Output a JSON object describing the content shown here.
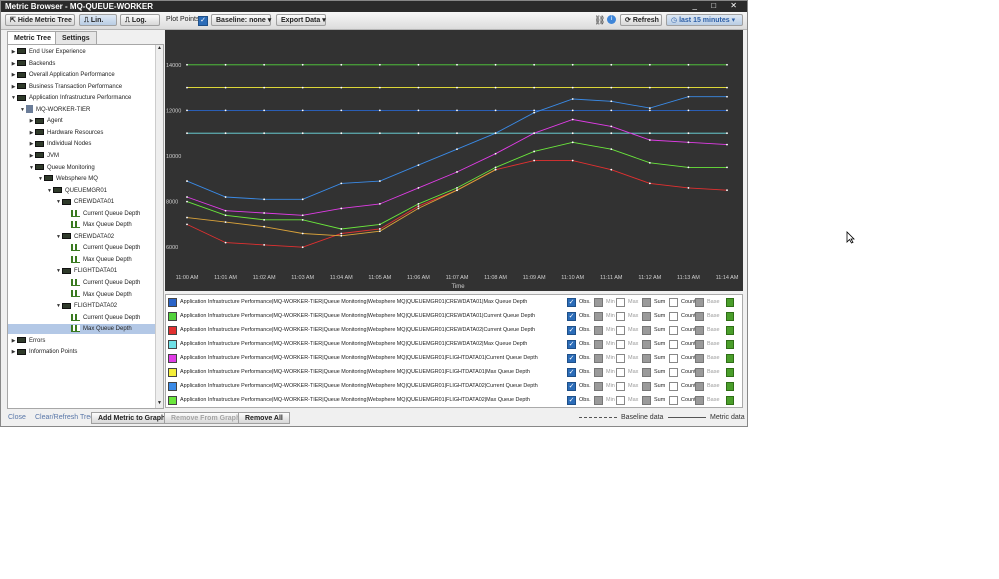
{
  "window": {
    "title": "Metric Browser - MQ-QUEUE-WORKER",
    "controls": [
      "_",
      "□",
      "✕"
    ]
  },
  "toolbar": {
    "hide_tree": "Hide Metric Tree",
    "lin": "Lin.",
    "log": "Log.",
    "plot_points": "Plot Points",
    "baseline_label": "Baseline:",
    "baseline_value": "none",
    "export": "Export Data",
    "refresh": "Refresh",
    "time_range": "last 15 minutes"
  },
  "left": {
    "tabs": [
      "Metric Tree",
      "Settings"
    ],
    "tree": [
      {
        "label": "End User Experience",
        "level": 0,
        "arrow": "▶",
        "icon": "folder"
      },
      {
        "label": "Backends",
        "level": 0,
        "arrow": "▶",
        "icon": "folder"
      },
      {
        "label": "Overall Application Performance",
        "level": 0,
        "arrow": "▶",
        "icon": "folder"
      },
      {
        "label": "Business Transaction Performance",
        "level": 0,
        "arrow": "▶",
        "icon": "folder"
      },
      {
        "label": "Application Infrastructure Performance",
        "level": 0,
        "arrow": "▼",
        "icon": "folder"
      },
      {
        "label": "MQ-WORKER-TIER",
        "level": 1,
        "arrow": "▼",
        "icon": "agent"
      },
      {
        "label": "Agent",
        "level": 2,
        "arrow": "▶",
        "icon": "folder"
      },
      {
        "label": "Hardware Resources",
        "level": 2,
        "arrow": "▶",
        "icon": "folder"
      },
      {
        "label": "Individual Nodes",
        "level": 2,
        "arrow": "▶",
        "icon": "folder"
      },
      {
        "label": "JVM",
        "level": 2,
        "arrow": "▶",
        "icon": "folder"
      },
      {
        "label": "Queue Monitoring",
        "level": 2,
        "arrow": "▼",
        "icon": "folder"
      },
      {
        "label": "Websphere MQ",
        "level": 3,
        "arrow": "▼",
        "icon": "folder"
      },
      {
        "label": "QUEUEMGR01",
        "level": 4,
        "arrow": "▼",
        "icon": "folder"
      },
      {
        "label": "CREWDATA01",
        "level": 5,
        "arrow": "▼",
        "icon": "folder"
      },
      {
        "label": "Current Queue Depth",
        "level": 6,
        "arrow": "",
        "icon": "metric"
      },
      {
        "label": "Max Queue Depth",
        "level": 6,
        "arrow": "",
        "icon": "metric"
      },
      {
        "label": "CREWDATA02",
        "level": 5,
        "arrow": "▼",
        "icon": "folder"
      },
      {
        "label": "Current Queue Depth",
        "level": 6,
        "arrow": "",
        "icon": "metric"
      },
      {
        "label": "Max Queue Depth",
        "level": 6,
        "arrow": "",
        "icon": "metric"
      },
      {
        "label": "FLIGHTDATA01",
        "level": 5,
        "arrow": "▼",
        "icon": "folder"
      },
      {
        "label": "Current Queue Depth",
        "level": 6,
        "arrow": "",
        "icon": "metric"
      },
      {
        "label": "Max Queue Depth",
        "level": 6,
        "arrow": "",
        "icon": "metric"
      },
      {
        "label": "FLIGHTDATA02",
        "level": 5,
        "arrow": "▼",
        "icon": "folder"
      },
      {
        "label": "Current Queue Depth",
        "level": 6,
        "arrow": "",
        "icon": "metric"
      },
      {
        "label": "Max Queue Depth",
        "level": 6,
        "arrow": "",
        "icon": "metric",
        "selected": true
      },
      {
        "label": "Errors",
        "level": 0,
        "arrow": "▶",
        "icon": "folder"
      },
      {
        "label": "Information Points",
        "level": 0,
        "arrow": "▶",
        "icon": "folder"
      }
    ]
  },
  "legend": {
    "options": [
      "Obs.",
      "Min",
      "Max",
      "Sum",
      "Count",
      "Base"
    ],
    "rows": [
      {
        "name": "Application Infrastructure Performance|MQ-WORKER-TIER|Queue Monitoring|Websphere MQ|QUEUEMGR01|CREWDATA01|Max Queue Depth",
        "color": "#2a64c8"
      },
      {
        "name": "Application Infrastructure Performance|MQ-WORKER-TIER|Queue Monitoring|Websphere MQ|QUEUEMGR01|CREWDATA01|Current Queue Depth",
        "color": "#52d23c"
      },
      {
        "name": "Application Infrastructure Performance|MQ-WORKER-TIER|Queue Monitoring|Websphere MQ|QUEUEMGR01|CREWDATA02|Current Queue Depth",
        "color": "#e23030"
      },
      {
        "name": "Application Infrastructure Performance|MQ-WORKER-TIER|Queue Monitoring|Websphere MQ|QUEUEMGR01|CREWDATA02|Max Queue Depth",
        "color": "#6fe0e6"
      },
      {
        "name": "Application Infrastructure Performance|MQ-WORKER-TIER|Queue Monitoring|Websphere MQ|QUEUEMGR01|FLIGHTDATA01|Current Queue Depth",
        "color": "#e03ce6"
      },
      {
        "name": "Application Infrastructure Performance|MQ-WORKER-TIER|Queue Monitoring|Websphere MQ|QUEUEMGR01|FLIGHTDATA01|Max Queue Depth",
        "color": "#f4ee3a"
      },
      {
        "name": "Application Infrastructure Performance|MQ-WORKER-TIER|Queue Monitoring|Websphere MQ|QUEUEMGR01|FLIGHTDATA02|Current Queue Depth",
        "color": "#3a8ae6"
      },
      {
        "name": "Application Infrastructure Performance|MQ-WORKER-TIER|Queue Monitoring|Websphere MQ|QUEUEMGR01|FLIGHTDATA02|Max Queue Depth",
        "color": "#6ae63c"
      }
    ]
  },
  "bottom": {
    "close": "Close",
    "clear_refresh": "Clear/Refresh Tree",
    "add_metric": "Add Metric to Graph",
    "remove_from_graph": "Remove From Graph",
    "remove_all": "Remove All",
    "baseline_data": "Baseline data",
    "metric_data": "Metric data"
  },
  "chart_data": {
    "type": "line",
    "xlabel": "Time",
    "ylabel": "",
    "ylim": [
      5000,
      15000
    ],
    "yticks": [
      6000,
      8000,
      10000,
      12000,
      14000
    ],
    "categories": [
      "11:00 AM",
      "11:01 AM",
      "11:02 AM",
      "11:03 AM",
      "11:04 AM",
      "11:05 AM",
      "11:06 AM",
      "11:07 AM",
      "11:08 AM",
      "11:09 AM",
      "11:10 AM",
      "11:11 AM",
      "11:12 AM",
      "11:13 AM",
      "11:14 AM"
    ],
    "grid": false,
    "series": [
      {
        "color": "#52d23c",
        "values": [
          14000,
          14000,
          14000,
          14000,
          14000,
          14000,
          14000,
          14000,
          14000,
          14000,
          14000,
          14000,
          14000,
          14000,
          14000
        ]
      },
      {
        "color": "#f4ee3a",
        "values": [
          13000,
          13000,
          13000,
          13000,
          13000,
          13000,
          13000,
          13000,
          13000,
          13000,
          13000,
          13000,
          13000,
          13000,
          13000
        ]
      },
      {
        "color": "#2a64c8",
        "values": [
          12000,
          12000,
          12000,
          12000,
          12000,
          12000,
          12000,
          12000,
          12000,
          12000,
          12000,
          12000,
          12000,
          12000,
          12000
        ]
      },
      {
        "color": "#6fe0e6",
        "values": [
          11000,
          11000,
          11000,
          11000,
          11000,
          11000,
          11000,
          11000,
          11000,
          11000,
          11000,
          11000,
          11000,
          11000,
          11000
        ]
      },
      {
        "color": "#3a8ae6",
        "values": [
          8900,
          8200,
          8100,
          8100,
          8800,
          8900,
          9600,
          10300,
          11000,
          11900,
          12500,
          12400,
          12100,
          12600,
          12600
        ]
      },
      {
        "color": "#e03ce6",
        "values": [
          8200,
          7600,
          7500,
          7400,
          7700,
          7900,
          8600,
          9300,
          10100,
          11000,
          11600,
          11300,
          10700,
          10600,
          10500
        ]
      },
      {
        "color": "#6ae63c",
        "values": [
          8000,
          7400,
          7200,
          7200,
          6800,
          7000,
          7900,
          8600,
          9500,
          10200,
          10600,
          10300,
          9700,
          9500,
          9500
        ]
      },
      {
        "color": "#e23030",
        "values": [
          7000,
          6200,
          6100,
          6000,
          6600,
          6800,
          7800,
          8500,
          9400,
          9800,
          9800,
          9400,
          8800,
          8600,
          8500
        ]
      },
      {
        "color": "#d9a23a",
        "values": [
          7300,
          7100,
          6900,
          6600,
          6500,
          6700,
          7700,
          8500,
          9400,
          null,
          null,
          null,
          null,
          null,
          null
        ]
      }
    ]
  }
}
